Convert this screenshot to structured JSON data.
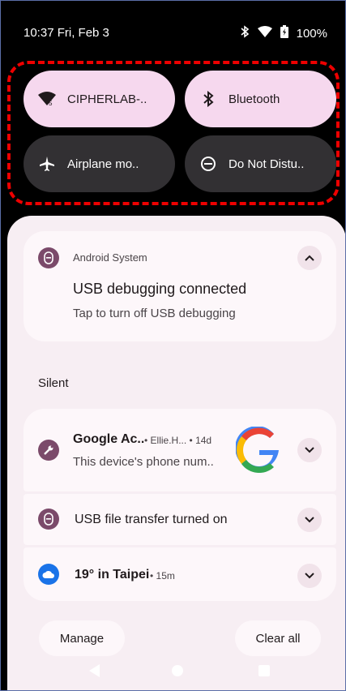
{
  "status": {
    "time": "10:37 Fri, Feb 3",
    "battery": "100%"
  },
  "tiles": [
    {
      "label": "CIPHERLAB-..",
      "icon": "wifi-icon",
      "state": "on"
    },
    {
      "label": "Bluetooth",
      "icon": "bluetooth-icon",
      "state": "on"
    },
    {
      "label": "Airplane mo..",
      "icon": "airplane-icon",
      "state": "off"
    },
    {
      "label": "Do Not Distu..",
      "icon": "do-not-disturb-icon",
      "state": "off"
    }
  ],
  "notification1": {
    "app": "Android System",
    "title": "USB debugging connected",
    "text": "Tap to turn off USB debugging"
  },
  "section_label": "Silent",
  "notification2": {
    "app": "Google Ac..",
    "sub": "• Ellie.H... • 14d",
    "text": "This device's phone num.."
  },
  "notification3": {
    "title": "USB file transfer turned on"
  },
  "notification4": {
    "title": "19° in Taipei",
    "meta": "• 15m"
  },
  "buttons": {
    "manage": "Manage",
    "clear_all": "Clear all"
  },
  "colors": {
    "accent": "#7b4a6a",
    "tile_on": "#f6d8ee",
    "tile_off": "#323033",
    "weather": "#1a73e8",
    "highlight": "#e00000"
  }
}
